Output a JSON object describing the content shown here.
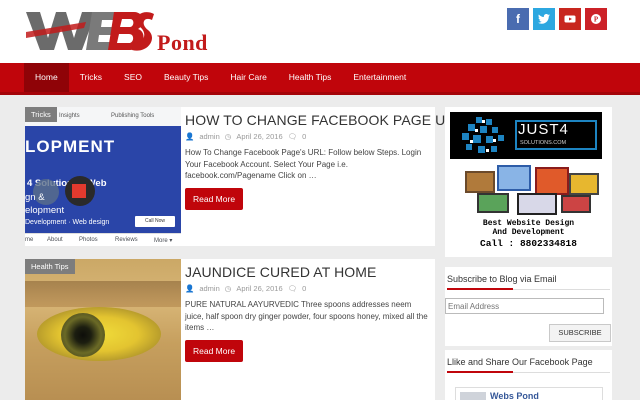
{
  "header": {
    "logo_pond": "Pond",
    "social": [
      {
        "name": "facebook",
        "glyph": "f",
        "color": "#4a6cb0"
      },
      {
        "name": "twitter",
        "glyph": "t",
        "color": "#2ca7e0"
      },
      {
        "name": "youtube",
        "glyph": "▶",
        "color": "#c8261e"
      },
      {
        "name": "pinterest",
        "glyph": "p",
        "color": "#cc2127"
      }
    ]
  },
  "nav": {
    "items": [
      "Home",
      "Tricks",
      "SEO",
      "Beauty Tips",
      "Hair Care",
      "Health Tips",
      "Entertainment"
    ],
    "active": "Home",
    "color": "#c0050b"
  },
  "posts": [
    {
      "category": "Tricks",
      "title": "HOW TO CHANGE FACEBOOK PAGE URL",
      "author": "admin",
      "date": "April 26, 2016",
      "comments": "0",
      "excerpt": "How To Change Facebook Page's URL: Follow below Steps. Login Your Facebook Account. Select Your Page i.e. facebook.com/Pagename Click on …",
      "read_more": "Read More",
      "thumb": {
        "top_tabs": [
          "Insights",
          "Publishing Tools"
        ],
        "banner_big": "LOPMENT",
        "banner_l1": "4 Solutions : Web",
        "banner_l2": "gn &",
        "banner_l3": "elopment",
        "banner_l4": "Development · Web design",
        "follow": "Call Now",
        "bottom_tabs": [
          "me",
          "About",
          "Photos",
          "Reviews",
          "More ▾"
        ]
      }
    },
    {
      "category": "Health Tips",
      "title": "JAUNDICE CURED AT HOME",
      "author": "admin",
      "date": "April 26, 2016",
      "comments": "0",
      "excerpt": "PURE NATURAL AAYURVEDIC Three spoons addresses neem juice, half spoon dry ginger powder, four spoons honey, mixed all the items …",
      "read_more": "Read More"
    }
  ],
  "sidebar": {
    "ad": {
      "brand": "JUST4",
      "brand_sub": "SOLUTIONS.COM",
      "line1": "Best Website Design",
      "line2": "And Development",
      "line3": "Call : 8802334818"
    },
    "subscribe": {
      "title": "Subscribe to Blog via Email",
      "placeholder": "Email Address",
      "button": "SUBSCRIBE"
    },
    "likebox": {
      "title": "Llike and Share Our Facebook Page",
      "page_name": "Webs Pond"
    }
  }
}
